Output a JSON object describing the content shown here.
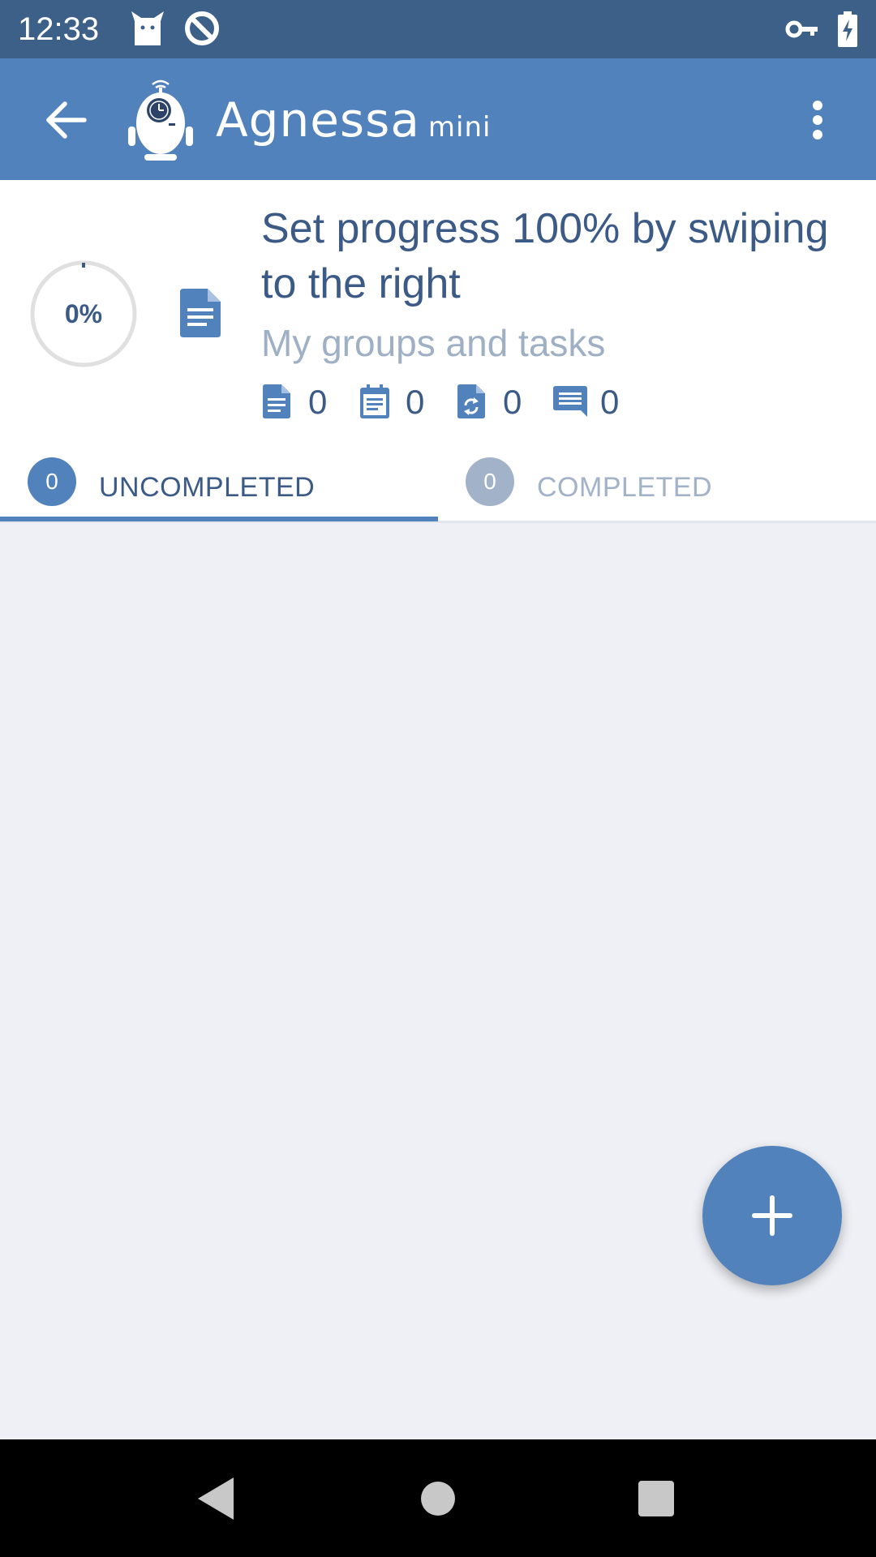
{
  "status_bar": {
    "time": "12:33",
    "icons": [
      "cat-notification-icon",
      "no-entry-notification-icon",
      "vpn-key-icon",
      "battery-charging-icon"
    ]
  },
  "app_bar": {
    "brand_name": "Agnessa",
    "brand_suffix": "mini",
    "back_icon": "arrow-back-icon",
    "menu_icon": "more-vert-icon"
  },
  "task": {
    "progress_label": "0%",
    "progress_fraction": 0,
    "title": "Set progress 100% by swiping to the right",
    "group": "My groups and tasks",
    "counters": [
      {
        "icon": "note-icon",
        "value": "0"
      },
      {
        "icon": "calendar-icon",
        "value": "0"
      },
      {
        "icon": "recurring-icon",
        "value": "0"
      },
      {
        "icon": "comment-icon",
        "value": "0"
      }
    ]
  },
  "tabs": [
    {
      "label": "UNCOMPLETED",
      "count": "0",
      "active": true
    },
    {
      "label": "COMPLETED",
      "count": "0",
      "active": false
    }
  ],
  "fab": {
    "icon": "plus-icon"
  },
  "colors": {
    "status_bar": "#3d6088",
    "app_bar": "#5282bb",
    "accent": "#5282bb",
    "title_text": "#3c5a86",
    "muted_text": "#9fb0c5",
    "content_bg": "#eef0f5"
  }
}
